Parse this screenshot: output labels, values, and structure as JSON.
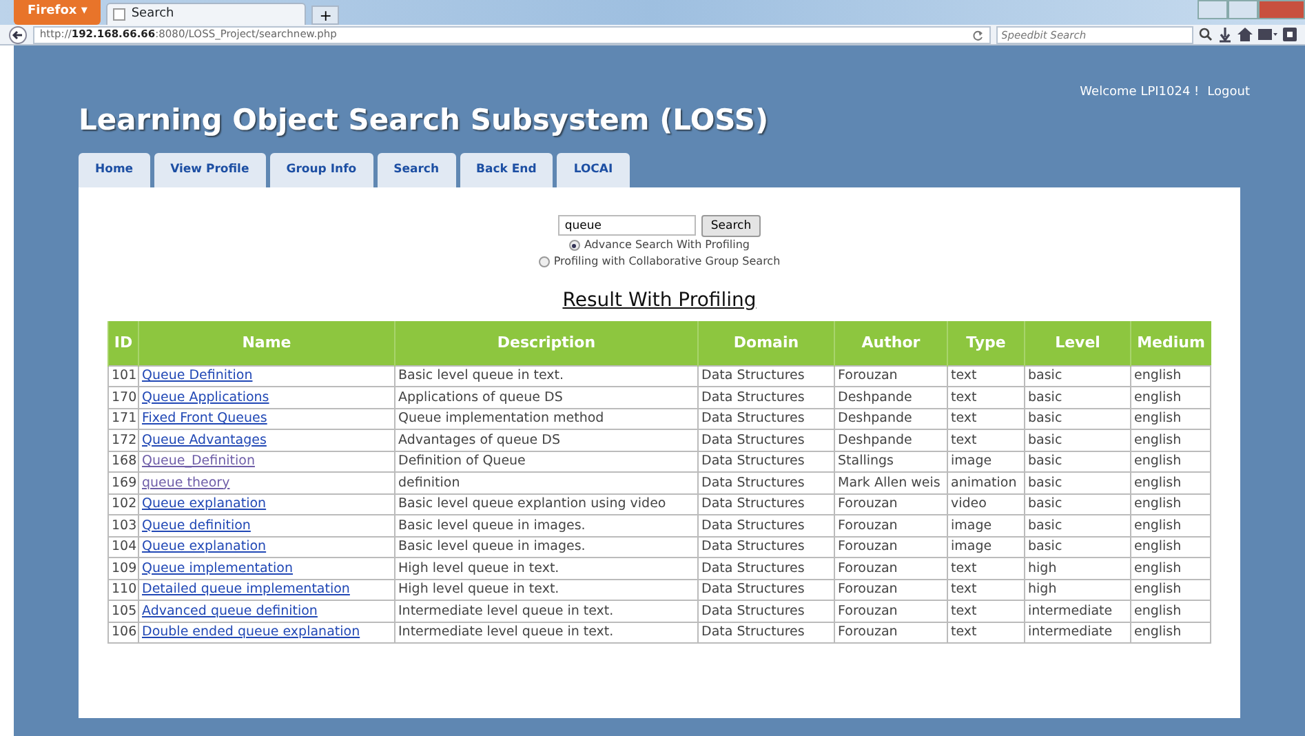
{
  "browser": {
    "menu_button": "Firefox ▾",
    "tab": {
      "title": "Search"
    },
    "new_tab": "+",
    "url": "http://**192.168.66.66**:8080/LOSS_Project/searchnew.php",
    "search_placeholder": "Speedbit Search"
  },
  "site": {
    "title": "Learning Object Search Subsystem (LOSS)",
    "welcome": "Welcome LPI1024 !",
    "logout": "Logout"
  },
  "nav_tabs": [
    "Home",
    "View Profile",
    "Group Info",
    "Search",
    "Back End",
    "LOCAI"
  ],
  "search": {
    "value": "queue",
    "button": "Search"
  },
  "options": [
    {
      "label": "Advance Search With Profiling",
      "selected": true
    },
    {
      "label": "Profiling with Collaborative Group Search",
      "selected": false
    }
  ],
  "results": {
    "title": "Result With Profiling",
    "columns": [
      "ID",
      "Name",
      "Description",
      "Domain",
      "Author",
      "Type",
      "Level",
      "Medium"
    ],
    "rows": [
      {
        "id": "101",
        "name": "Queue Definition",
        "visited": false,
        "description": "Basic level queue in text.",
        "domain": "Data Structures",
        "author": "Forouzan",
        "type": "text",
        "level": "basic",
        "medium": "english"
      },
      {
        "id": "170",
        "name": "Queue Applications",
        "visited": false,
        "description": "Applications of queue DS",
        "domain": "Data Structures",
        "author": "Deshpande",
        "type": "text",
        "level": "basic",
        "medium": "english"
      },
      {
        "id": "171",
        "name": "Fixed Front Queues",
        "visited": false,
        "description": "Queue implementation method",
        "domain": "Data Structures",
        "author": "Deshpande",
        "type": "text",
        "level": "basic",
        "medium": "english"
      },
      {
        "id": "172",
        "name": "Queue Advantages",
        "visited": false,
        "description": "Advantages of queue DS",
        "domain": "Data Structures",
        "author": "Deshpande",
        "type": "text",
        "level": "basic",
        "medium": "english"
      },
      {
        "id": "168",
        "name": "Queue_Definition",
        "visited": true,
        "description": "Definition of Queue",
        "domain": "Data Structures",
        "author": "Stallings",
        "type": "image",
        "level": "basic",
        "medium": "english"
      },
      {
        "id": "169",
        "name": "queue theory",
        "visited": true,
        "description": "definition",
        "domain": "Data Structures",
        "author": "Mark Allen weis",
        "type": "animation",
        "level": "basic",
        "medium": "english"
      },
      {
        "id": "102",
        "name": "Queue explanation",
        "visited": false,
        "description": "Basic level queue explantion using video",
        "domain": "Data Structures",
        "author": "Forouzan",
        "type": "video",
        "level": "basic",
        "medium": "english"
      },
      {
        "id": "103",
        "name": "Queue definition",
        "visited": false,
        "description": "Basic level queue in images.",
        "domain": "Data Structures",
        "author": "Forouzan",
        "type": "image",
        "level": "basic",
        "medium": "english"
      },
      {
        "id": "104",
        "name": "Queue explanation",
        "visited": false,
        "description": "Basic level queue in images.",
        "domain": "Data Structures",
        "author": "Forouzan",
        "type": "image",
        "level": "basic",
        "medium": "english"
      },
      {
        "id": "109",
        "name": "Queue implementation",
        "visited": false,
        "description": "High level queue in text.",
        "domain": "Data Structures",
        "author": "Forouzan",
        "type": "text",
        "level": "high",
        "medium": "english"
      },
      {
        "id": "110",
        "name": "Detailed queue implementation",
        "visited": false,
        "description": "High level queue in text.",
        "domain": "Data Structures",
        "author": "Forouzan",
        "type": "text",
        "level": "high",
        "medium": "english"
      },
      {
        "id": "105",
        "name": "Advanced queue definition",
        "visited": false,
        "description": "Intermediate level queue in text.",
        "domain": "Data Structures",
        "author": "Forouzan",
        "type": "text",
        "level": "intermediate",
        "medium": "english"
      },
      {
        "id": "106",
        "name": "Double ended queue explanation",
        "visited": false,
        "description": "Intermediate level queue in text.",
        "domain": "Data Structures",
        "author": "Forouzan",
        "type": "text",
        "level": "intermediate",
        "medium": "english"
      }
    ]
  }
}
